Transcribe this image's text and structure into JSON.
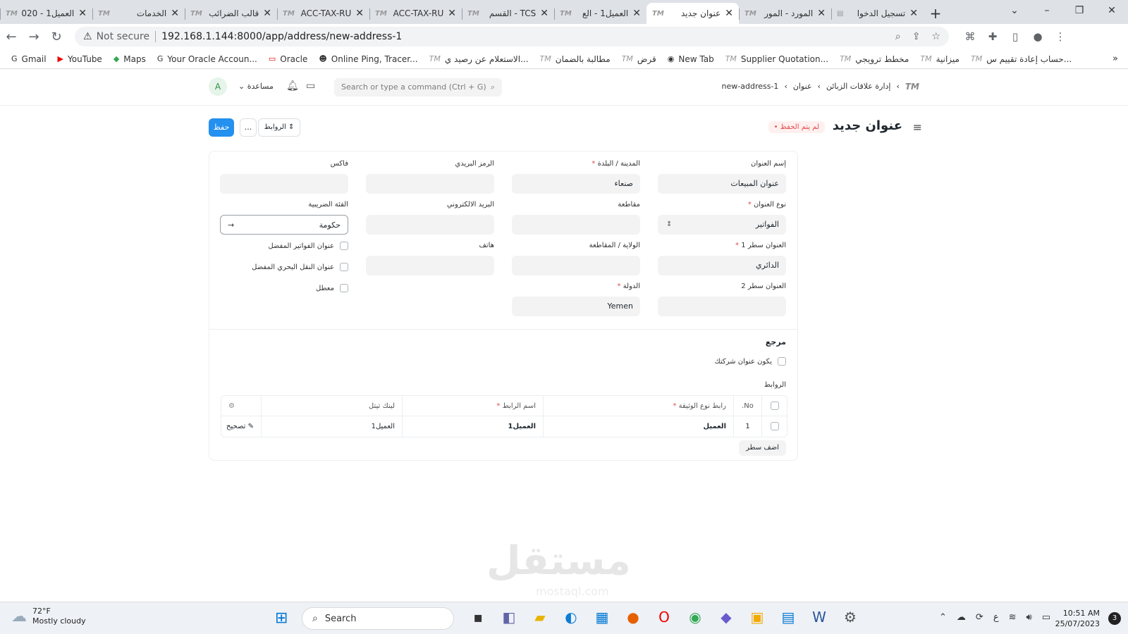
{
  "browser": {
    "tabs": [
      {
        "title": "العميل1 - 020"
      },
      {
        "title": "الخدمات"
      },
      {
        "title": "قالب الضرائب"
      },
      {
        "title": "ACC-TAX-RU"
      },
      {
        "title": "ACC-TAX-RU"
      },
      {
        "title": "TCS - القسم"
      },
      {
        "title": "العميل1 - الع"
      },
      {
        "title": "عنوان جديد"
      },
      {
        "title": "المورد - المور"
      },
      {
        "title": "تسجيل الدخوا"
      }
    ],
    "favicon_text": "TM",
    "not_secure": "Not secure",
    "url": "192.168.1.144:8000/app/address/new-address-1",
    "bookmarks": [
      {
        "label": "Gmail",
        "icon": "G"
      },
      {
        "label": "YouTube",
        "icon": "▶"
      },
      {
        "label": "Maps",
        "icon": "◆"
      },
      {
        "label": "Your Oracle Accoun...",
        "icon": "G"
      },
      {
        "label": "Oracle",
        "icon": "▭"
      },
      {
        "label": "Online Ping, Tracer...",
        "icon": "☻"
      },
      {
        "label": "الاستعلام عن رصيد ي...",
        "icon": "TM"
      },
      {
        "label": "مطالبة بالضمان",
        "icon": "TM"
      },
      {
        "label": "قرض",
        "icon": "TM"
      },
      {
        "label": "New Tab",
        "icon": "◉"
      },
      {
        "label": "Supplier Quotation...",
        "icon": "TM"
      },
      {
        "label": "مخطط ترويجي",
        "icon": "TM"
      },
      {
        "label": "ميزانية",
        "icon": "TM"
      },
      {
        "label": "حساب إعادة تقييم س...",
        "icon": "TM"
      }
    ]
  },
  "navbar": {
    "avatar": "A",
    "help": "مساعدة",
    "search_placeholder": "Search or type a command (Ctrl + G)",
    "breadcrumbs": [
      "إدارة علاقات الزبائن",
      "عنوان",
      "new-address-1"
    ]
  },
  "page": {
    "title": "عنوان جديد",
    "status": "لم يتم الحفظ",
    "save": "حفظ",
    "more": "...",
    "links": "الروابط"
  },
  "form": {
    "address_title": {
      "label": "إسم العنوان",
      "value": "عنوان المبيعات"
    },
    "city": {
      "label": "المدينة / البلدة",
      "value": "صنعاء"
    },
    "pincode": {
      "label": "الرمز البريدي",
      "value": ""
    },
    "fax": {
      "label": "فاكس",
      "value": ""
    },
    "address_type": {
      "label": "نوع العنوان",
      "value": "الفواتير"
    },
    "county": {
      "label": "مقاطعة",
      "value": ""
    },
    "email": {
      "label": "البريد الالكتروني",
      "value": ""
    },
    "tax_category": {
      "label": "الفئة الضريبية",
      "value": "حكومة"
    },
    "address_line1": {
      "label": "العنوان سطر 1",
      "value": "الدائري"
    },
    "state": {
      "label": "الولاية / المقاطعة",
      "value": ""
    },
    "phone": {
      "label": "هاتف",
      "value": ""
    },
    "address_line2": {
      "label": "العنوان سطر 2",
      "value": ""
    },
    "country": {
      "label": "الدولة",
      "value": "Yemen"
    },
    "preferred_billing": "عنوان الفواتير المفضل",
    "preferred_shipping": "عنوان النقل البحري المفضل",
    "disabled": "معطل",
    "reference_heading": "مرجع",
    "is_company_address": "يكون عنوان شركتك",
    "links_label": "الروابط",
    "table": {
      "headers": [
        "No.",
        "رابط نوع الوثيقة",
        "اسم الرابط",
        "لينك تيتل"
      ],
      "rows": [
        {
          "no": "1",
          "doctype": "العميل",
          "name": "العميل1",
          "title": "العميل1",
          "edit": "تصحيح"
        }
      ]
    },
    "add_row": "اضف سطر"
  },
  "watermark": "مستقل",
  "watermark_sub": "mostaql.com",
  "taskbar": {
    "temp": "72°F",
    "weather": "Mostly cloudy",
    "search": "Search",
    "time": "10:51 AM",
    "date": "25/07/2023",
    "notifications": "3",
    "lang": "ع"
  }
}
